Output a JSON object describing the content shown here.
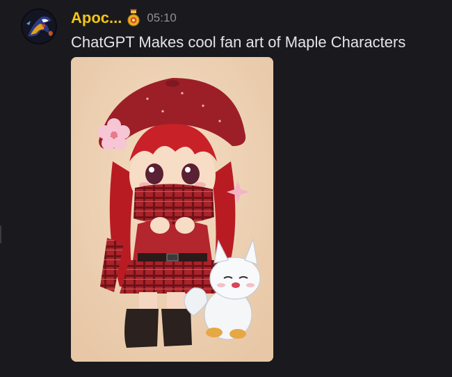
{
  "message": {
    "author": "Apoc...",
    "timestamp": "05:10",
    "text": "ChatGPT Makes cool fan art of Maple Characters",
    "avatar_icon": "dark-hooded-character-avatar",
    "badge_icon": "medal-badge-icon",
    "author_color": "#f3c615",
    "attachment": {
      "kind": "image",
      "subject": "chibi-girl-red-hat-scarf-with-white-fox-illustration"
    }
  }
}
